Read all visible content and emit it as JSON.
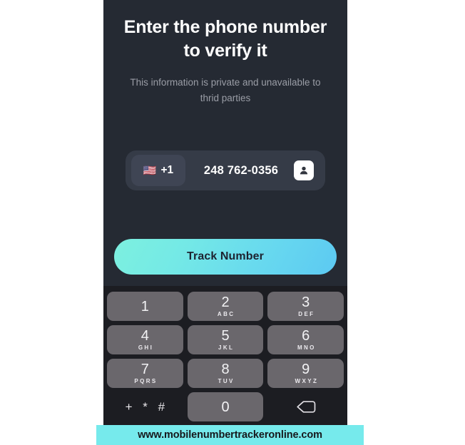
{
  "screen": {
    "headline": "Enter the phone number to verify it",
    "subtitle": "This information is private and unavailable to thrid parties",
    "background_color": "#252a33"
  },
  "phone_input": {
    "country_code": "+1",
    "flag": "🇺🇸",
    "flag_icon_name": "us-flag-icon",
    "number": "248 762-0356",
    "contacts_icon_name": "contact-person-icon"
  },
  "track_button": {
    "label": "Track Number",
    "gradient_from": "#7df0df",
    "gradient_to": "#5cc9f2",
    "text_color": "#1d2330"
  },
  "keypad": {
    "key_color": "#6a676c",
    "background_color": "#1c1d22",
    "rows": [
      [
        {
          "digit": "1",
          "letters": ""
        },
        {
          "digit": "2",
          "letters": "ABC"
        },
        {
          "digit": "3",
          "letters": "DEF"
        }
      ],
      [
        {
          "digit": "4",
          "letters": "GHI"
        },
        {
          "digit": "5",
          "letters": "JKL"
        },
        {
          "digit": "6",
          "letters": "MNO"
        }
      ],
      [
        {
          "digit": "7",
          "letters": "PQRS"
        },
        {
          "digit": "8",
          "letters": "TUV"
        },
        {
          "digit": "9",
          "letters": "WXYZ"
        }
      ]
    ],
    "bottom_row": {
      "symbols_label": "+ * #",
      "zero_digit": "0",
      "backspace_icon_name": "backspace-icon"
    }
  },
  "watermark": {
    "text": "www.mobilenumbertrackeronline.com",
    "background_color": "#76eaec",
    "text_color": "#16181c"
  }
}
